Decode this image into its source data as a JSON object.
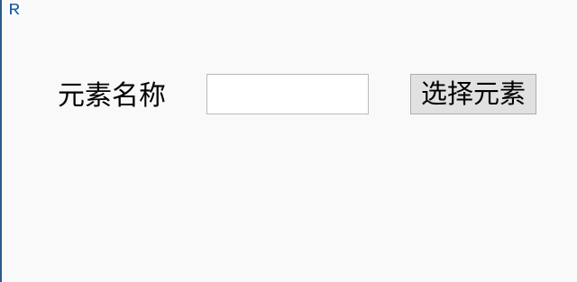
{
  "window": {
    "icon": "r-app-icon",
    "border_color": "#2b5a8a",
    "background": "#f9f9f9"
  },
  "form": {
    "label": "元素名称",
    "input_value": "",
    "input_placeholder": "",
    "button_label": "选择元素"
  }
}
